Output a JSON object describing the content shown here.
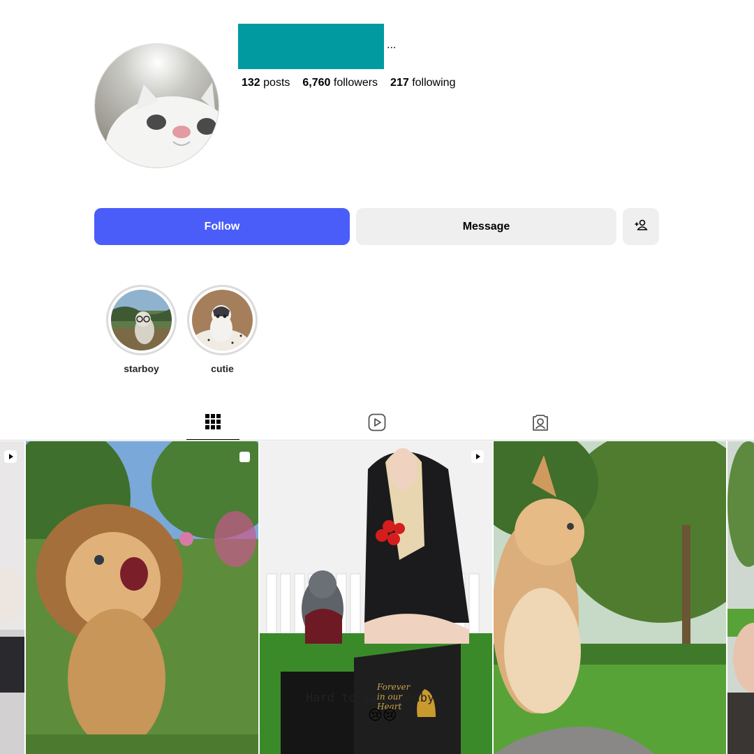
{
  "profile": {
    "username_redacted_color": "#009aa0",
    "more_label": "...",
    "stats": [
      {
        "value": "132",
        "label": "posts"
      },
      {
        "value": "6,760",
        "label": "followers"
      },
      {
        "value": "217",
        "label": "following"
      }
    ]
  },
  "actions": {
    "follow_label": "Follow",
    "message_label": "Message",
    "suggest_icon": "add-person-icon"
  },
  "highlights": [
    {
      "label": "starboy",
      "icon": "highlight-cat-glasses"
    },
    {
      "label": "cutie",
      "icon": "highlight-cat-kitten"
    }
  ],
  "tabs": [
    {
      "name": "posts",
      "icon": "grid-icon",
      "active": true
    },
    {
      "name": "reels",
      "icon": "reels-icon",
      "active": false
    },
    {
      "name": "tagged",
      "icon": "tagged-icon",
      "active": false
    }
  ],
  "posts": [
    {
      "name": "post-partial-left",
      "badge": "reel-icon"
    },
    {
      "name": "post-lion-cat",
      "badge": "carousel-icon"
    },
    {
      "name": "post-goodbye",
      "badge": "reel-icon",
      "caption": "Hard to say goodbye",
      "box_text": "Forever in our Heart"
    },
    {
      "name": "post-orange-cat",
      "badge": ""
    },
    {
      "name": "post-partial-right",
      "badge": ""
    }
  ],
  "colors": {
    "follow_button": "#4a5df9",
    "secondary_button": "#efefef",
    "username_block": "#009aa0"
  }
}
